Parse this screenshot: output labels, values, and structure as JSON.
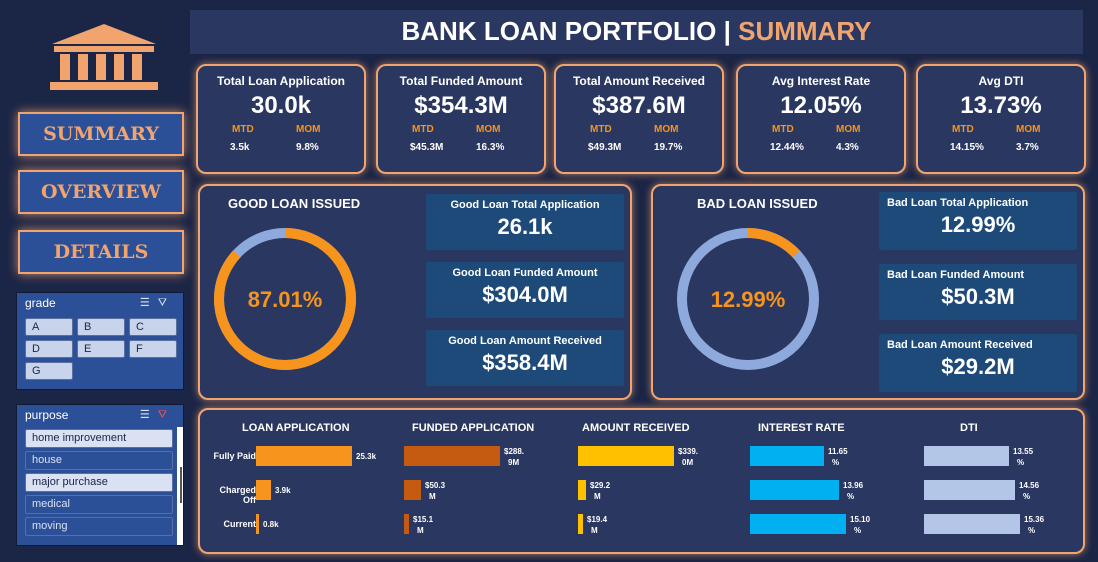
{
  "title": {
    "main": "BANK LOAN PORTFOLIO |",
    "accent": "SUMMARY"
  },
  "nav": {
    "summary": "SUMMARY",
    "overview": "OVERVIEW",
    "details": "DETAILS"
  },
  "grade_slicer": {
    "title": "grade",
    "items": [
      "A",
      "B",
      "C",
      "D",
      "E",
      "F",
      "G"
    ]
  },
  "purpose_slicer": {
    "title": "purpose",
    "items": [
      "home improvement",
      "house",
      "major purchase",
      "medical",
      "moving"
    ]
  },
  "kpis": [
    {
      "label": "Total Loan Application",
      "value": "30.0k",
      "mtd_label": "MTD",
      "mom_label": "MOM",
      "mtd": "3.5k",
      "mom": "9.8%"
    },
    {
      "label": "Total Funded Amount",
      "value": "$354.3M",
      "mtd_label": "MTD",
      "mom_label": "MOM",
      "mtd": "$45.3M",
      "mom": "16.3%"
    },
    {
      "label": "Total Amount Received",
      "value": "$387.6M",
      "mtd_label": "MTD",
      "mom_label": "MOM",
      "mtd": "$49.3M",
      "mom": "19.7%"
    },
    {
      "label": "Avg Interest Rate",
      "value": "12.05%",
      "mtd_label": "MTD",
      "mom_label": "MOM",
      "mtd": "12.44%",
      "mom": "4.3%"
    },
    {
      "label": "Avg DTI",
      "value": "13.73%",
      "mtd_label": "MTD",
      "mom_label": "MOM",
      "mtd": "14.15%",
      "mom": "3.7%"
    }
  ],
  "good_loan": {
    "title": "GOOD LOAN ISSUED",
    "percent_label": "87.01%",
    "percent": 87.01,
    "stats": [
      {
        "label": "Good Loan Total Application",
        "value": "26.1k"
      },
      {
        "label": "Good Loan Funded Amount",
        "value": "$304.0M"
      },
      {
        "label": "Good Loan Amount Received",
        "value": "$358.4M"
      }
    ]
  },
  "bad_loan": {
    "title": "BAD LOAN ISSUED",
    "percent_label": "12.99%",
    "percent": 12.99,
    "stats": [
      {
        "label": "Bad Loan Total Application",
        "value": "12.99%"
      },
      {
        "label": "Bad Loan Funded Amount",
        "value": "$50.3M"
      },
      {
        "label": "Bad Loan Amount Received",
        "value": "$29.2M"
      }
    ]
  },
  "colors": {
    "accent": "#f1a46e",
    "ring": "#f7941d",
    "ring_rest": "#8ea9db",
    "loan_app": "#f7941d",
    "funded": "#c55a11",
    "received": "#ffc000",
    "interest": "#00b0f0",
    "dti": "#b4c6e7"
  },
  "status_rows": [
    "Fully Paid",
    "Charged Off",
    "Current"
  ],
  "metrics": [
    {
      "key": "loan_app",
      "header": "LOAN APPLICATION",
      "values": [
        25.3,
        3.9,
        0.8
      ],
      "max": 25.3,
      "labels": [
        [
          "25.3k"
        ],
        [
          "3.9k"
        ],
        [
          "0.8k"
        ]
      ]
    },
    {
      "key": "funded",
      "header": "FUNDED APPLICATION",
      "values": [
        288.9,
        50.3,
        15.1
      ],
      "max": 288.9,
      "labels": [
        [
          "$288.",
          "9M"
        ],
        [
          "$50.3",
          "M"
        ],
        [
          "$15.1",
          "M"
        ]
      ]
    },
    {
      "key": "received",
      "header": "AMOUNT RECEIVED",
      "values": [
        339.0,
        29.2,
        19.4
      ],
      "max": 339.0,
      "labels": [
        [
          "$339.",
          "0M"
        ],
        [
          "$29.2",
          "M"
        ],
        [
          "$19.4",
          "M"
        ]
      ]
    },
    {
      "key": "interest",
      "header": "INTEREST RATE",
      "values": [
        11.65,
        13.96,
        15.1
      ],
      "max": 15.1,
      "labels": [
        [
          "11.65",
          "%"
        ],
        [
          "13.96",
          "%"
        ],
        [
          "15.10",
          "%"
        ]
      ]
    },
    {
      "key": "dti",
      "header": "DTI",
      "values": [
        13.55,
        14.56,
        15.36
      ],
      "max": 15.36,
      "labels": [
        [
          "13.55",
          "%"
        ],
        [
          "14.56",
          "%"
        ],
        [
          "15.36",
          "%"
        ]
      ]
    }
  ]
}
